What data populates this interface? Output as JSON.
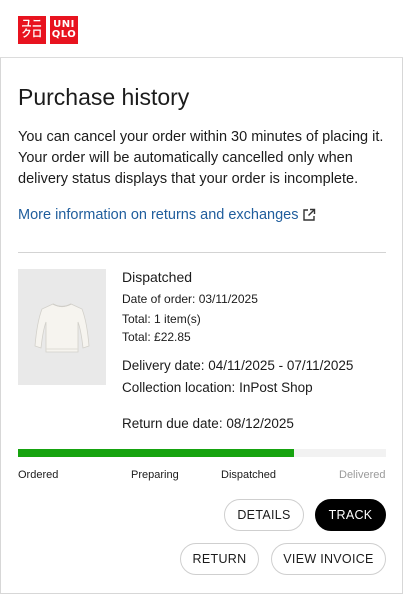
{
  "brand": {
    "logo_left": [
      "ユニ",
      "クロ"
    ],
    "logo_right": [
      "UNI",
      "QLO"
    ],
    "color": "#e8131f"
  },
  "page": {
    "title": "Purchase history",
    "intro": "You can cancel your order within 30 minutes of placing it. Your order will be automatically cancelled only when delivery status displays that your order is incomplete.",
    "info_link": "More information on returns and exchanges",
    "info_link_icon": "external-link-icon"
  },
  "order": {
    "status": "Dispatched",
    "date_of_order": "Date of order: 03/11/2025",
    "total_items": "Total: 1 item(s)",
    "total_price": "Total: £22.85",
    "delivery_date": "Delivery date: 04/11/2025 - 07/11/2025",
    "collection_location": "Collection location: InPost Shop",
    "return_due_date": "Return due date: 08/12/2025",
    "thumbnail_icon": "sweater-icon"
  },
  "progress": {
    "fraction": 0.75,
    "color": "#16a30f",
    "steps": [
      "Ordered",
      "Preparing",
      "Dispatched",
      "Delivered"
    ]
  },
  "actions": {
    "details": "DETAILS",
    "track": "TRACK",
    "return": "RETURN",
    "view_invoice": "VIEW INVOICE"
  }
}
